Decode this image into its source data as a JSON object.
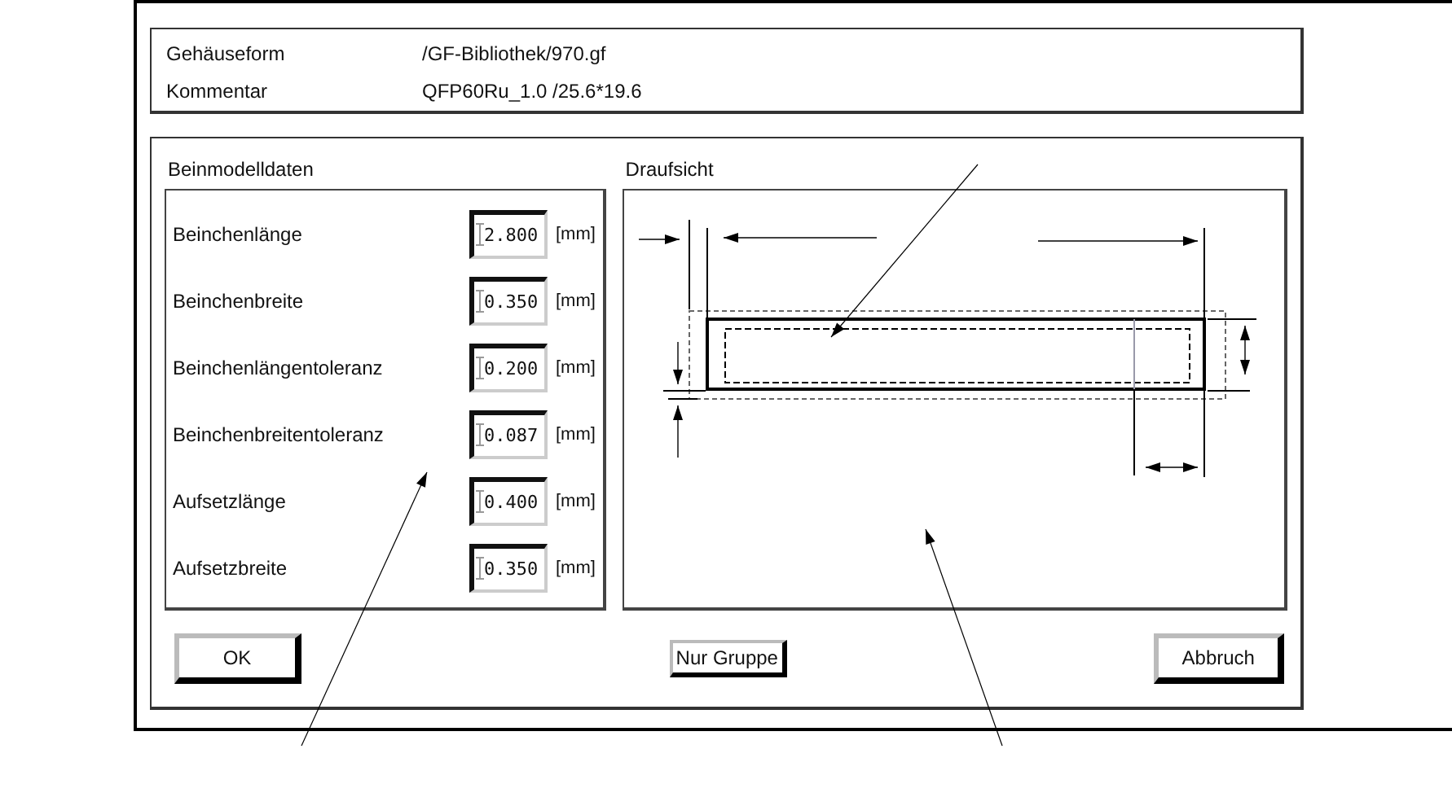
{
  "header": {
    "rows": [
      {
        "label": "Gehäuseform",
        "value": "/GF-Bibliothek/970.gf"
      },
      {
        "label": "Kommentar",
        "value": "QFP60Ru_1.0 /25.6*19.6"
      }
    ]
  },
  "pin_model": {
    "title": "Beinmodelldaten",
    "fields": [
      {
        "label": "Beinchenlänge",
        "value": "2.800",
        "unit": "[mm]"
      },
      {
        "label": "Beinchenbreite",
        "value": "0.350",
        "unit": "[mm]"
      },
      {
        "label": "Beinchenlängentoleranz",
        "value": "0.200",
        "unit": "[mm]"
      },
      {
        "label": "Beinchenbreitentoleranz",
        "value": "0.087",
        "unit": "[mm]"
      },
      {
        "label": "Aufsetzlänge",
        "value": "0.400",
        "unit": "[mm]"
      },
      {
        "label": "Aufsetzbreite",
        "value": "0.350",
        "unit": "[mm]"
      }
    ]
  },
  "top_view": {
    "title": "Draufsicht"
  },
  "buttons": [
    {
      "label": "OK",
      "kind": "large"
    },
    {
      "label": "Nur Gruppe",
      "kind": "small"
    },
    {
      "label": "Abbruch",
      "kind": "large"
    }
  ]
}
